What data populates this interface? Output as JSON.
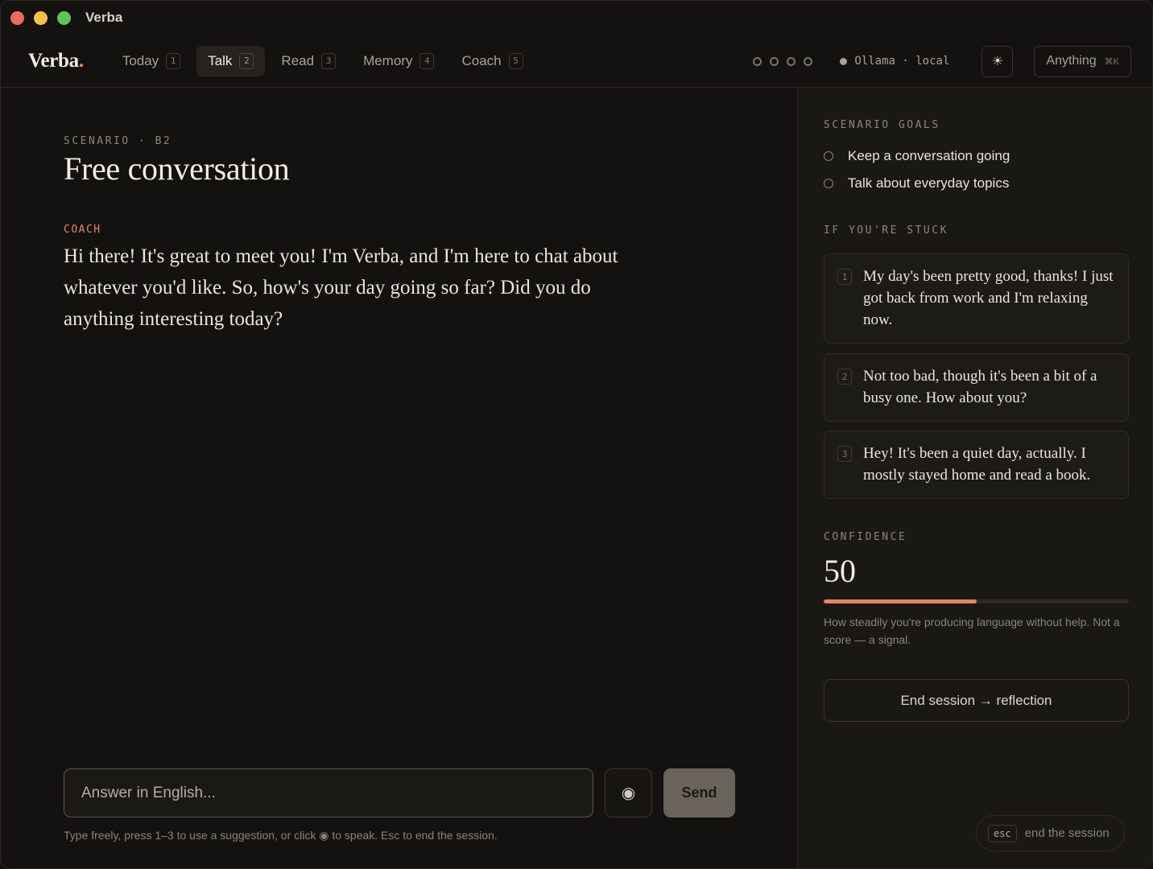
{
  "window": {
    "title": "Verba"
  },
  "nav": {
    "logo": "Verba",
    "logo_dot": ".",
    "tabs": [
      {
        "label": "Today",
        "key": "1"
      },
      {
        "label": "Talk",
        "key": "2",
        "active": true
      },
      {
        "label": "Read",
        "key": "3"
      },
      {
        "label": "Memory",
        "key": "4"
      },
      {
        "label": "Coach",
        "key": "5"
      }
    ],
    "model": "Ollama · local",
    "theme_icon": "☀",
    "anything_label": "Anything",
    "anything_shortcut": "⌘K"
  },
  "main": {
    "scenario_label": "SCENARIO · B2",
    "scenario_title": "Free conversation",
    "coach_label": "COACH",
    "coach_message": "Hi there! It's great to meet you! I'm Verba, and I'm here to chat about whatever you'd like. So, how's your day going so far? Did you do anything interesting today?",
    "input_placeholder": "Answer in English...",
    "mic_icon": "◉",
    "send_label": "Send",
    "hint": "Type freely, press 1–3 to use a suggestion, or click ◉ to speak. Esc to end the session."
  },
  "side": {
    "goals_label": "SCENARIO GOALS",
    "goals": [
      "Keep a conversation going",
      "Talk about everyday topics"
    ],
    "stuck_label": "IF YOU'RE STUCK",
    "suggestions": [
      {
        "key": "1",
        "text": "My day's been pretty good, thanks! I just got back from work and I'm relaxing now."
      },
      {
        "key": "2",
        "text": "Not too bad, though it's been a bit of a busy one. How about you?"
      },
      {
        "key": "3",
        "text": "Hey! It's been a quiet day, actually. I mostly stayed home and read a book."
      }
    ],
    "confidence_label": "CONFIDENCE",
    "confidence_value": "50",
    "confidence_fraction": 0.5,
    "confidence_desc": "How steadily you're producing language without help. Not a score — a signal.",
    "end_session_label": "End session → reflection",
    "esc_key": "esc",
    "esc_label": "end the session"
  },
  "colors": {
    "accent": "#df8a63",
    "background": "#141210",
    "panel": "#1a1815"
  }
}
